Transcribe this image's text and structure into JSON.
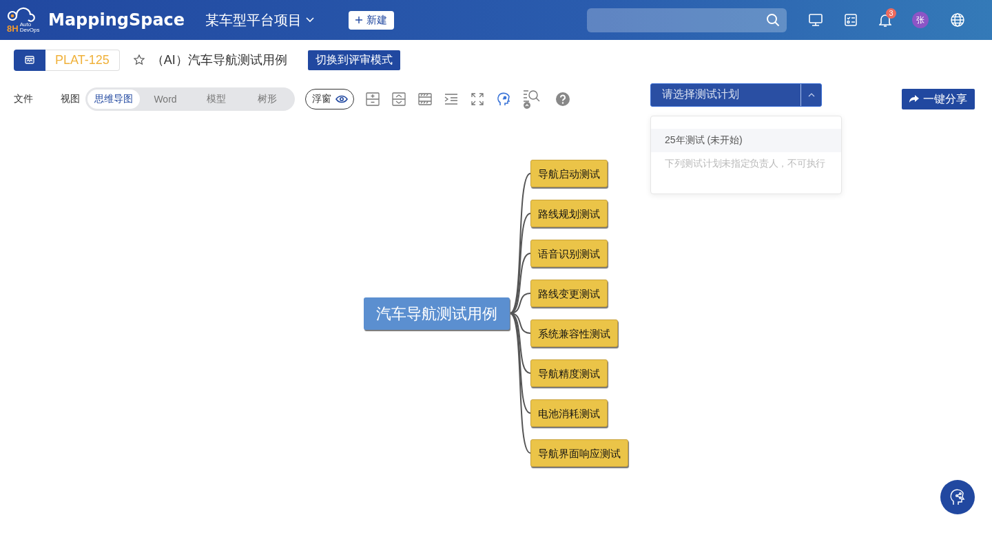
{
  "header": {
    "logo_mark": "8H",
    "logo_sub": [
      "Auto",
      "DevOps"
    ],
    "brand": "MappingSpace",
    "project": "某车型平台项目",
    "new_button": "新建",
    "notification_count": "3",
    "avatar": "张"
  },
  "document": {
    "id": "PLAT-125",
    "title": "（AI）汽车导航测试用例",
    "review_button": "切换到评审模式"
  },
  "toolbar": {
    "menus": [
      "文件",
      "视图"
    ],
    "views": [
      {
        "label": "思维导图",
        "selected": true
      },
      {
        "label": "Word",
        "selected": false
      },
      {
        "label": "模型",
        "selected": false
      },
      {
        "label": "树形",
        "selected": false
      }
    ],
    "float_button": "浮窗"
  },
  "plan_select": {
    "placeholder": "请选择测试计划",
    "expanded": true,
    "options": [
      {
        "kind": "option",
        "label": "25年测试 (未开始)"
      },
      {
        "kind": "note",
        "label": "下列测试计划未指定负责人，不可执行"
      }
    ]
  },
  "share_button": "一键分享",
  "mind_map": {
    "root": "汽车导航测试用例",
    "children": [
      "导航启动测试",
      "路线规划测试",
      "语音识别测试",
      "路线变更测试",
      "系统兼容性测试",
      "导航精度测试",
      "电池消耗测试",
      "导航界面响应测试"
    ]
  }
}
